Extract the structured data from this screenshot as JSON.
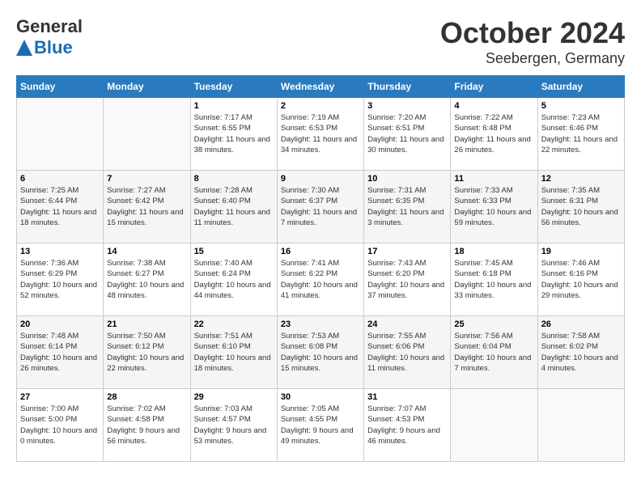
{
  "logo": {
    "general": "General",
    "blue": "Blue"
  },
  "title": "October 2024",
  "location": "Seebergen, Germany",
  "weekdays": [
    "Sunday",
    "Monday",
    "Tuesday",
    "Wednesday",
    "Thursday",
    "Friday",
    "Saturday"
  ],
  "weeks": [
    [
      {
        "day": "",
        "info": ""
      },
      {
        "day": "",
        "info": ""
      },
      {
        "day": "1",
        "info": "Sunrise: 7:17 AM\nSunset: 6:55 PM\nDaylight: 11 hours\nand 38 minutes."
      },
      {
        "day": "2",
        "info": "Sunrise: 7:19 AM\nSunset: 6:53 PM\nDaylight: 11 hours\nand 34 minutes."
      },
      {
        "day": "3",
        "info": "Sunrise: 7:20 AM\nSunset: 6:51 PM\nDaylight: 11 hours\nand 30 minutes."
      },
      {
        "day": "4",
        "info": "Sunrise: 7:22 AM\nSunset: 6:48 PM\nDaylight: 11 hours\nand 26 minutes."
      },
      {
        "day": "5",
        "info": "Sunrise: 7:23 AM\nSunset: 6:46 PM\nDaylight: 11 hours\nand 22 minutes."
      }
    ],
    [
      {
        "day": "6",
        "info": "Sunrise: 7:25 AM\nSunset: 6:44 PM\nDaylight: 11 hours\nand 18 minutes."
      },
      {
        "day": "7",
        "info": "Sunrise: 7:27 AM\nSunset: 6:42 PM\nDaylight: 11 hours\nand 15 minutes."
      },
      {
        "day": "8",
        "info": "Sunrise: 7:28 AM\nSunset: 6:40 PM\nDaylight: 11 hours\nand 11 minutes."
      },
      {
        "day": "9",
        "info": "Sunrise: 7:30 AM\nSunset: 6:37 PM\nDaylight: 11 hours\nand 7 minutes."
      },
      {
        "day": "10",
        "info": "Sunrise: 7:31 AM\nSunset: 6:35 PM\nDaylight: 11 hours\nand 3 minutes."
      },
      {
        "day": "11",
        "info": "Sunrise: 7:33 AM\nSunset: 6:33 PM\nDaylight: 10 hours\nand 59 minutes."
      },
      {
        "day": "12",
        "info": "Sunrise: 7:35 AM\nSunset: 6:31 PM\nDaylight: 10 hours\nand 56 minutes."
      }
    ],
    [
      {
        "day": "13",
        "info": "Sunrise: 7:36 AM\nSunset: 6:29 PM\nDaylight: 10 hours\nand 52 minutes."
      },
      {
        "day": "14",
        "info": "Sunrise: 7:38 AM\nSunset: 6:27 PM\nDaylight: 10 hours\nand 48 minutes."
      },
      {
        "day": "15",
        "info": "Sunrise: 7:40 AM\nSunset: 6:24 PM\nDaylight: 10 hours\nand 44 minutes."
      },
      {
        "day": "16",
        "info": "Sunrise: 7:41 AM\nSunset: 6:22 PM\nDaylight: 10 hours\nand 41 minutes."
      },
      {
        "day": "17",
        "info": "Sunrise: 7:43 AM\nSunset: 6:20 PM\nDaylight: 10 hours\nand 37 minutes."
      },
      {
        "day": "18",
        "info": "Sunrise: 7:45 AM\nSunset: 6:18 PM\nDaylight: 10 hours\nand 33 minutes."
      },
      {
        "day": "19",
        "info": "Sunrise: 7:46 AM\nSunset: 6:16 PM\nDaylight: 10 hours\nand 29 minutes."
      }
    ],
    [
      {
        "day": "20",
        "info": "Sunrise: 7:48 AM\nSunset: 6:14 PM\nDaylight: 10 hours\nand 26 minutes."
      },
      {
        "day": "21",
        "info": "Sunrise: 7:50 AM\nSunset: 6:12 PM\nDaylight: 10 hours\nand 22 minutes."
      },
      {
        "day": "22",
        "info": "Sunrise: 7:51 AM\nSunset: 6:10 PM\nDaylight: 10 hours\nand 18 minutes."
      },
      {
        "day": "23",
        "info": "Sunrise: 7:53 AM\nSunset: 6:08 PM\nDaylight: 10 hours\nand 15 minutes."
      },
      {
        "day": "24",
        "info": "Sunrise: 7:55 AM\nSunset: 6:06 PM\nDaylight: 10 hours\nand 11 minutes."
      },
      {
        "day": "25",
        "info": "Sunrise: 7:56 AM\nSunset: 6:04 PM\nDaylight: 10 hours\nand 7 minutes."
      },
      {
        "day": "26",
        "info": "Sunrise: 7:58 AM\nSunset: 6:02 PM\nDaylight: 10 hours\nand 4 minutes."
      }
    ],
    [
      {
        "day": "27",
        "info": "Sunrise: 7:00 AM\nSunset: 5:00 PM\nDaylight: 10 hours\nand 0 minutes."
      },
      {
        "day": "28",
        "info": "Sunrise: 7:02 AM\nSunset: 4:58 PM\nDaylight: 9 hours\nand 56 minutes."
      },
      {
        "day": "29",
        "info": "Sunrise: 7:03 AM\nSunset: 4:57 PM\nDaylight: 9 hours\nand 53 minutes."
      },
      {
        "day": "30",
        "info": "Sunrise: 7:05 AM\nSunset: 4:55 PM\nDaylight: 9 hours\nand 49 minutes."
      },
      {
        "day": "31",
        "info": "Sunrise: 7:07 AM\nSunset: 4:53 PM\nDaylight: 9 hours\nand 46 minutes."
      },
      {
        "day": "",
        "info": ""
      },
      {
        "day": "",
        "info": ""
      }
    ]
  ]
}
